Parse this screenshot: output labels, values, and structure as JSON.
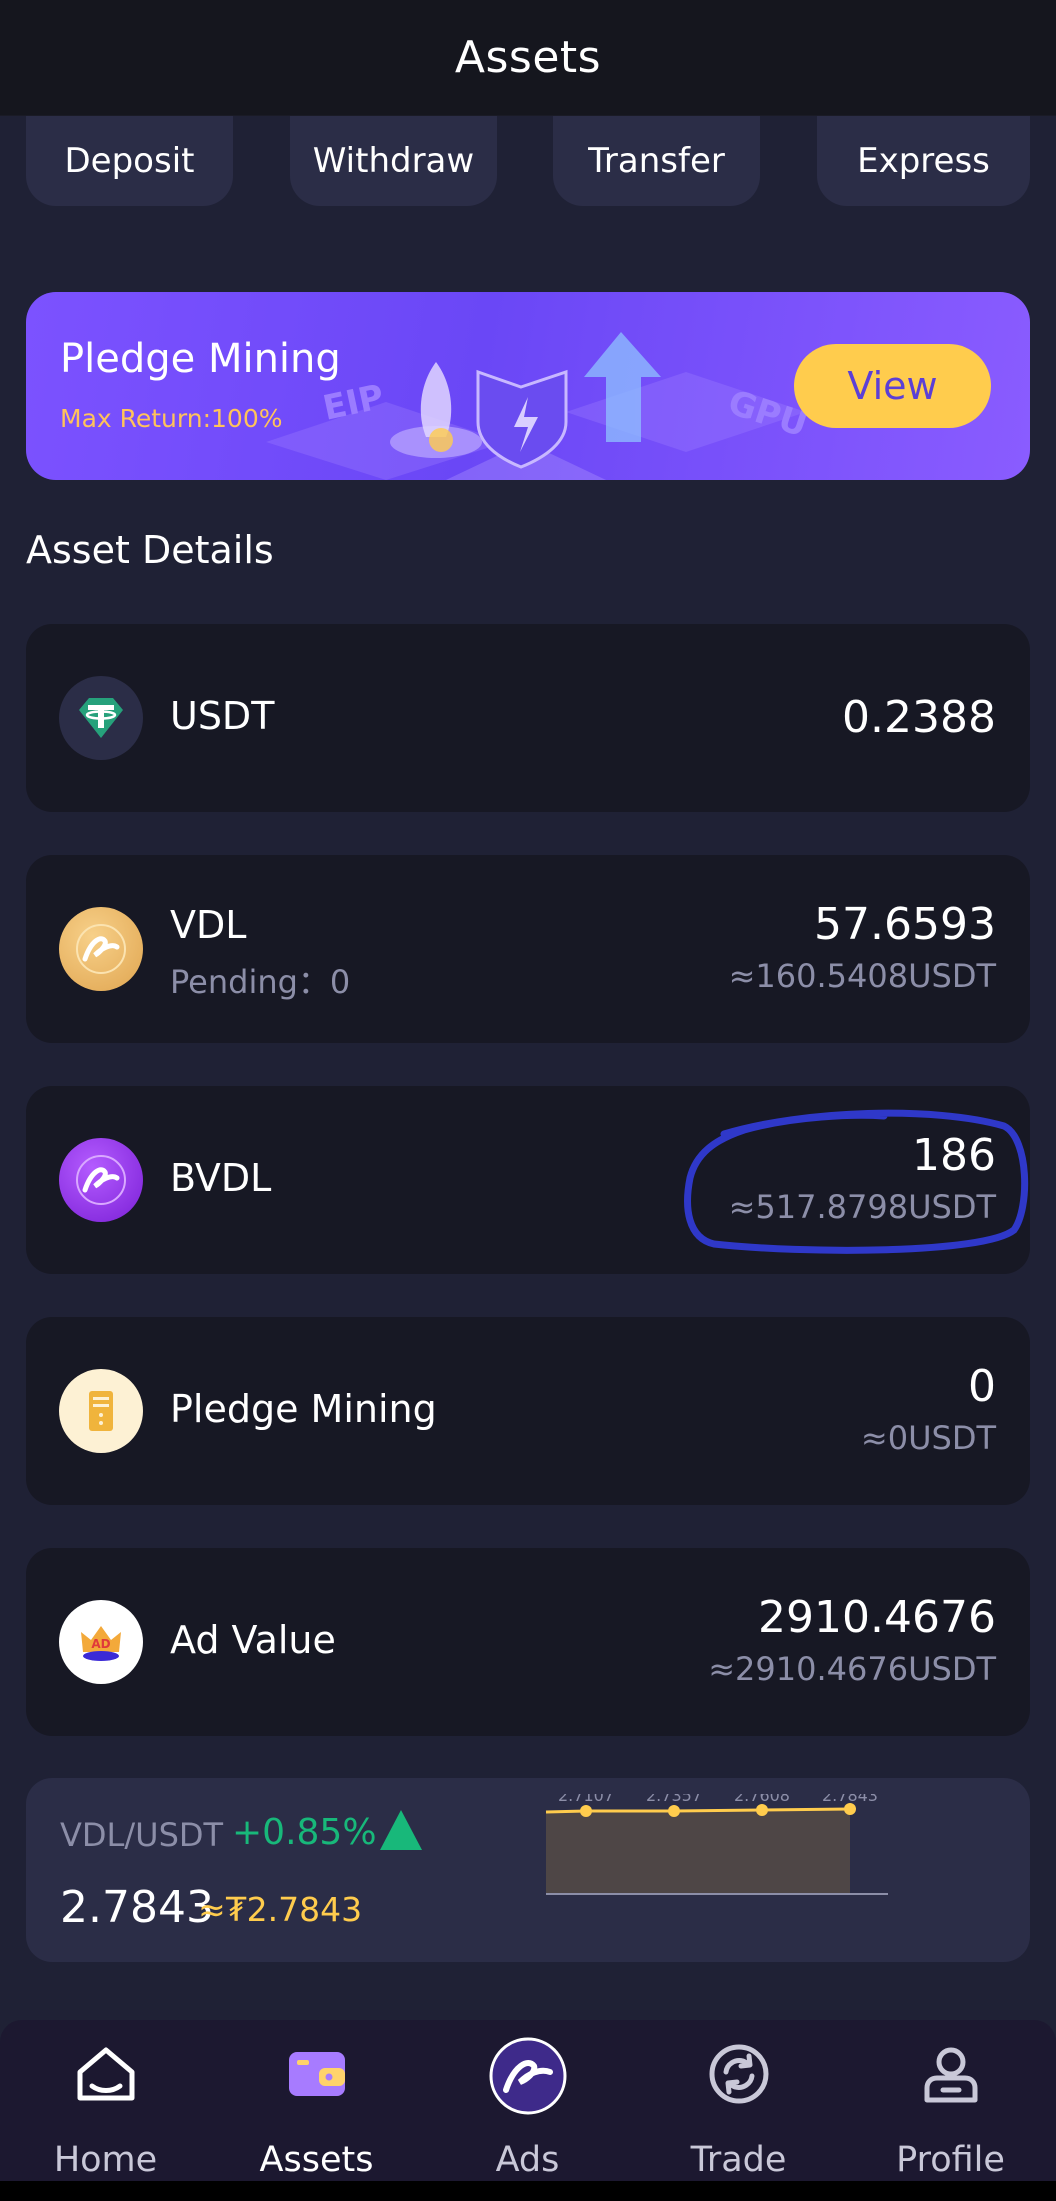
{
  "header": {
    "title": "Assets"
  },
  "actions": [
    {
      "label": "Deposit"
    },
    {
      "label": "Withdraw"
    },
    {
      "label": "Transfer"
    },
    {
      "label": "Express"
    }
  ],
  "banner": {
    "title": "Pledge Mining",
    "subtitle": "Max Return:100%",
    "button": "View",
    "art_text_1": "EIP",
    "art_text_2": "GPU"
  },
  "section_title": "Asset Details",
  "assets": [
    {
      "name": "USDT",
      "amount": "0.2388",
      "icon": "tether-icon"
    },
    {
      "name": "VDL",
      "pending": "Pending：0",
      "amount": "57.6593",
      "usdt": "≈160.5408USDT",
      "icon": "vdl-coin-icon"
    },
    {
      "name": "BVDL",
      "amount": "186",
      "usdt": "≈517.8798USDT",
      "icon": "bvdl-coin-icon"
    },
    {
      "name": "Pledge Mining",
      "amount": "0",
      "usdt": "≈0USDT",
      "icon": "server-icon"
    },
    {
      "name": "Ad Value",
      "amount": "2910.4676",
      "usdt": "≈2910.4676USDT",
      "icon": "ad-crown-icon"
    }
  ],
  "ticker": {
    "pair": "VDL/USDT",
    "change": "+0.85%",
    "price": "2.7843",
    "approx": "≈₮2.7843",
    "spark_labels": [
      "2.7107",
      "2.7357",
      "2.7608",
      "2.7843"
    ],
    "up_color": "#18b87a"
  },
  "nav": [
    {
      "label": "Home",
      "icon": "home-icon",
      "active": false
    },
    {
      "label": "Assets",
      "icon": "wallet-icon",
      "active": true
    },
    {
      "label": "Ads",
      "icon": "ads-logo-icon",
      "active": false
    },
    {
      "label": "Trade",
      "icon": "trade-refresh-icon",
      "active": false
    },
    {
      "label": "Profile",
      "icon": "profile-icon",
      "active": false
    }
  ],
  "colors": {
    "accent": "#7c52ff",
    "gold": "#ffcc4d",
    "card": "#171824",
    "background": "#1f2135"
  }
}
